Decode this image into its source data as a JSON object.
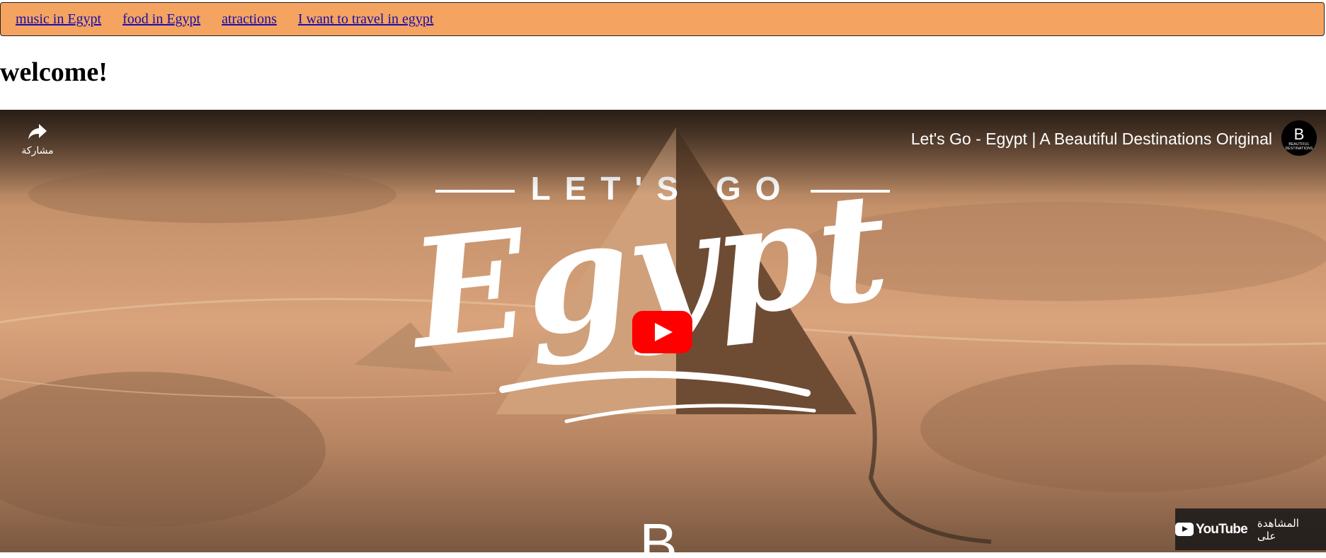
{
  "nav": {
    "links": [
      "music in Egypt",
      "food in Egypt",
      "atractions",
      "I want to travel in egypt"
    ]
  },
  "heading": "welcome!",
  "video": {
    "title": "Let's Go - Egypt | A Beautiful Destinations Original",
    "share_label": "مشاركة",
    "channel_letter": "B",
    "channel_sub": "BEAUTIFUL DESTINATIONS",
    "overlay_top": "LET'S GO",
    "overlay_main": "Egypt",
    "overlay_bottom": "B",
    "watch_label": "المشاهدة على",
    "youtube_word": "YouTube"
  },
  "colors": {
    "navbar_bg": "#f4a460",
    "link": "#1a0dab",
    "play_button": "#ff0000"
  },
  "icons": [
    "share-icon",
    "youtube-play-icon",
    "youtube-logo-icon"
  ]
}
